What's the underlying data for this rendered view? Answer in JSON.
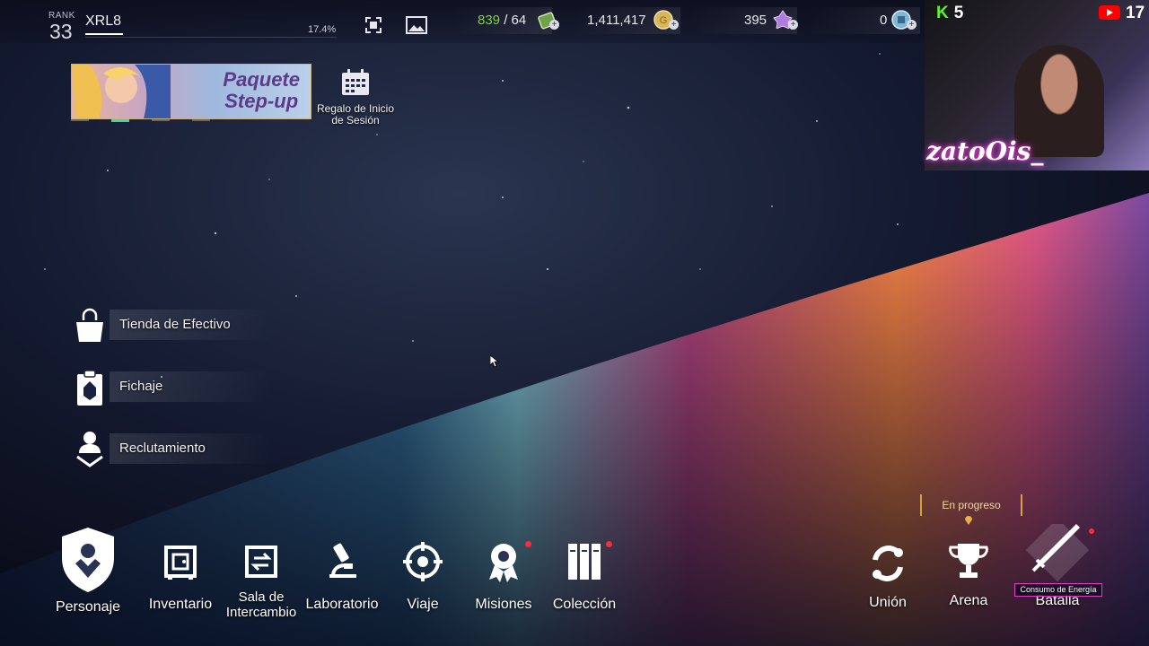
{
  "header": {
    "rank_label": "RANK",
    "rank": "33",
    "player_name": "XRL8",
    "exp_percent": "17.4%"
  },
  "resources": [
    {
      "name": "energy",
      "current": "839",
      "max": "/ 64",
      "icon": "battery-icon",
      "color": "#7ed24a"
    },
    {
      "name": "gold",
      "value": "1,411,417",
      "icon": "gold-coin-icon",
      "color": "#d9b55a"
    },
    {
      "name": "gems",
      "value": "395",
      "icon": "crystal-icon",
      "color": "#b17be0"
    },
    {
      "name": "tickets",
      "value": "0",
      "icon": "ticket-coin-icon",
      "color": "#7fb6d8"
    }
  ],
  "banner": {
    "title_line1": "Paquete",
    "title_line2": "Step-up"
  },
  "login_gift": {
    "label_line1": "Regalo de Inicio",
    "label_line2": "de Sesión"
  },
  "side_menu": [
    {
      "id": "cash-shop",
      "label": "Tienda de Efectivo",
      "icon": "shopping-bag-icon"
    },
    {
      "id": "signing",
      "label": "Fichaje",
      "icon": "clipboard-icon"
    },
    {
      "id": "recruitment",
      "label": "Reclutamiento",
      "icon": "recruit-icon"
    }
  ],
  "bottom_nav": [
    {
      "id": "character",
      "label": "Personaje",
      "icon": "character-shield-icon",
      "badge": false
    },
    {
      "id": "inventory",
      "label": "Inventario",
      "icon": "safe-icon",
      "badge": false
    },
    {
      "id": "exchange",
      "label": "Sala de",
      "label2": "Intercambio",
      "icon": "exchange-icon",
      "badge": false
    },
    {
      "id": "lab",
      "label": "Laboratorio",
      "icon": "microscope-icon",
      "badge": false
    },
    {
      "id": "travel",
      "label": "Viaje",
      "icon": "crosshair-icon",
      "badge": false
    },
    {
      "id": "missions",
      "label": "Misiones",
      "icon": "medal-icon",
      "badge": true
    },
    {
      "id": "collection",
      "label": "Colección",
      "icon": "books-icon",
      "badge": true
    }
  ],
  "right_nav": [
    {
      "id": "union",
      "label": "Unión",
      "icon": "union-icon"
    },
    {
      "id": "arena",
      "label": "Arena",
      "icon": "trophy-icon"
    },
    {
      "id": "battle",
      "label": "Batalla",
      "icon": "sword-icon"
    }
  ],
  "status": {
    "in_progress": "En progreso",
    "energy_consumption": "Consumo de Energía"
  },
  "stream_overlay": {
    "handle": "zatoOis_",
    "kick_viewers": "5",
    "youtube_viewers": "17",
    "kick_color": "#53fc18",
    "youtube_color": "#ff0000"
  }
}
